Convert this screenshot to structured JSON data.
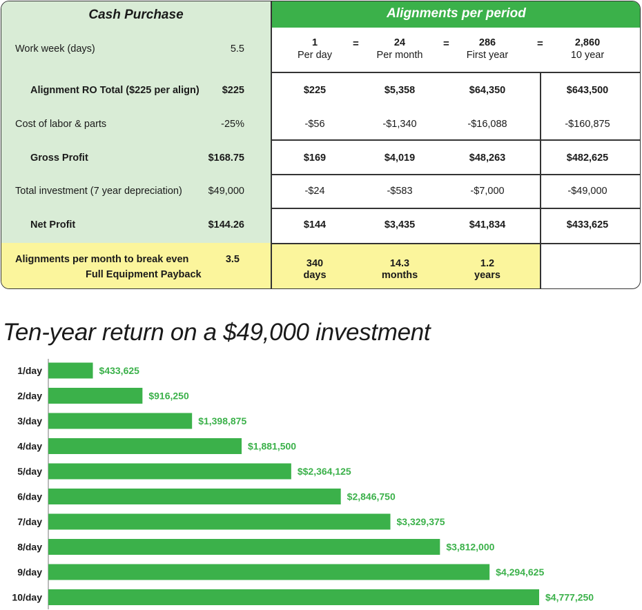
{
  "table": {
    "left_title": "Cash Purchase",
    "right_title": "Alignments per period",
    "equals": "=",
    "periods": [
      {
        "value": "1",
        "label": "Per day"
      },
      {
        "value": "24",
        "label": "Per month"
      },
      {
        "value": "286",
        "label": "First year"
      },
      {
        "value": "2,860",
        "label": "10 year"
      }
    ],
    "rows": [
      {
        "label": "Alignment RO Total ($225 per align)",
        "value": "$225",
        "cells": [
          "$225",
          "$5,358",
          "$64,350",
          "$643,500"
        ]
      },
      {
        "label": "Cost of labor & parts",
        "value": "-25%",
        "cells": [
          "-$56",
          "-$1,340",
          "-$16,088",
          "-$160,875"
        ]
      },
      {
        "label": "Gross Profit",
        "value": "$168.75",
        "cells": [
          "$169",
          "$4,019",
          "$48,263",
          "$482,625"
        ]
      },
      {
        "label": "Total investment (7 year depreciation)",
        "value": "$49,000",
        "cells": [
          "-$24",
          "-$583",
          "-$7,000",
          "-$49,000"
        ]
      },
      {
        "label": "Net Profit",
        "value": "$144.26",
        "cells": [
          "$144",
          "$3,435",
          "$41,834",
          "$433,625"
        ]
      }
    ],
    "work_week": {
      "label": "Work week (days)",
      "value": "5.5"
    },
    "breakeven": {
      "label": "Alignments per month to break even",
      "value": "3.5",
      "payback_label": "Full Equipment Payback",
      "payback": [
        {
          "value": "340",
          "unit": "days"
        },
        {
          "value": "14.3",
          "unit": "months"
        },
        {
          "value": "1.2",
          "unit": "years"
        }
      ]
    }
  },
  "chart_data": {
    "type": "bar",
    "orientation": "horizontal",
    "title": "Ten-year return on a $49,000 investment",
    "bar_color": "#3bb14a",
    "categories": [
      "1/day",
      "2/day",
      "3/day",
      "4/day",
      "5/day",
      "6/day",
      "7/day",
      "8/day",
      "9/day",
      "10/day"
    ],
    "values": [
      433625,
      916250,
      1398875,
      1881500,
      2364125,
      2846750,
      3329375,
      3812000,
      4294625,
      4777250
    ],
    "labels": [
      "$433,625",
      "$916,250",
      "$1,398,875",
      "$1,881,500",
      "$$2,364,125",
      "$2,846,750",
      "$3,329,375",
      "$3,812,000",
      "$4,294,625",
      "$4,777,250"
    ]
  }
}
